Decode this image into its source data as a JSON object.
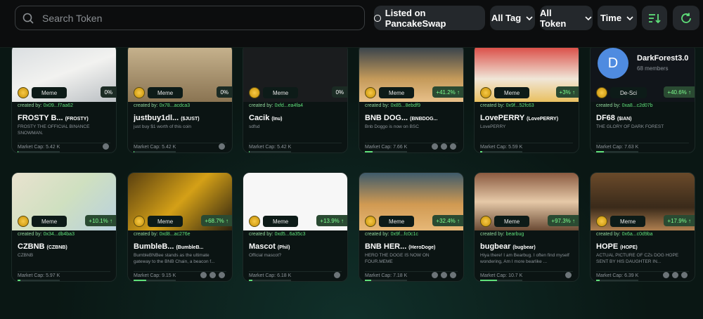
{
  "search": {
    "placeholder": "Search Token"
  },
  "filters": {
    "listed": "Listed on PancakeSwap",
    "tag": "All Tag",
    "token": "All Token",
    "time": "Time"
  },
  "colors": {
    "accent": "#5fe07a",
    "bg": "#0a1714",
    "topbar": "#0c0d0e"
  },
  "cards": [
    {
      "tag": "Meme",
      "pct": "0%",
      "creator": "0x09...f7aa62",
      "name": "FROSTY B...",
      "ticker": "(FROSTY)",
      "desc": "FROSTY THE OFFICIAL BINANCE SNOWMAN.",
      "market_cap": "Market Cap: 5.42 K",
      "progress": 0.02
    },
    {
      "tag": "Meme",
      "pct": "0%",
      "creator": "0x78...acdca3",
      "name": "justbuy1dl...",
      "ticker": "($JUST)",
      "desc": "just buy $1 worth of this coin",
      "market_cap": "Market Cap: 5.42 K",
      "progress": 0.02
    },
    {
      "tag": "Meme",
      "pct": "0%",
      "creator": "0xfd...ea4fa4",
      "name": "Cacik",
      "ticker": "(Inu)",
      "desc": "sdfsd",
      "market_cap": "Market Cap: 5.42 K",
      "progress": 0.02
    },
    {
      "tag": "Meme",
      "pct": "+41.2% ↑",
      "creator": "0x85...8ebdf9",
      "name": "BNB DOG...",
      "ticker": "(BNBDOG...",
      "desc": "Bnb Doggo is now on BSC",
      "market_cap": "Market Cap: 7.66 K",
      "progress": 0.18
    },
    {
      "tag": "Meme",
      "pct": "+3% ↑",
      "creator": "0x9f...52fc63",
      "name": "LovePERRY",
      "ticker": "(LovePERRY)",
      "desc": "LovePERRY",
      "market_cap": "Market Cap: 5.59 K",
      "progress": 0.05
    },
    {
      "tag": "De-Sci",
      "pct": "+40.6% ↑",
      "creator": "0xa8...c2d07b",
      "name": "DF68",
      "ticker": "($IAN)",
      "desc": "THE GLORY OF DARK FOREST",
      "market_cap": "Market Cap: 7.63 K",
      "progress": 0.18,
      "community_name": "DarkForest3.0",
      "community_members": "68 members",
      "community_letter": "D"
    },
    {
      "tag": "Meme",
      "pct": "+10.1% ↑",
      "creator": "0x34...db4ba3",
      "name": "CZBNB",
      "ticker": "(CZBNB)",
      "desc": "CZBNB",
      "market_cap": "Market Cap: 5.97 K",
      "progress": 0.06
    },
    {
      "tag": "Meme",
      "pct": "+68.7% ↑",
      "creator": "0xd8...ac276e",
      "name": "BumbleB...",
      "ticker": "(BumbleB...",
      "desc": "BumbleBNBee stands as the ultimate gateway to the BNB Chain, a beacon f...",
      "market_cap": "Market Cap: 9.15 K",
      "progress": 0.3
    },
    {
      "tag": "Meme",
      "pct": "+13.9% ↑",
      "creator": "0xd5...6a35c3",
      "name": "Mascot",
      "ticker": "(Phil)",
      "desc": "Official mascot?",
      "market_cap": "Market Cap: 6.18 K",
      "progress": 0.08
    },
    {
      "tag": "Meme",
      "pct": "+32.4% ↑",
      "creator": "0x9f...fc0c1c",
      "name": "BNB HER...",
      "ticker": "(HeroDoge)",
      "desc": "HERO THE DOGE IS NOW ON FOUR.MEME",
      "market_cap": "Market Cap: 7.18 K",
      "progress": 0.15
    },
    {
      "tag": "Meme",
      "pct": "+97.3% ↑",
      "creator": "bearbug",
      "name": "bugbear",
      "ticker": "(bugbear)",
      "desc": "Hiya there! I am Bearbug. I often find myself wondering, Am I more bearlike ...",
      "market_cap": "Market Cap: 10.7 K",
      "progress": 0.4
    },
    {
      "tag": "Meme",
      "pct": "+17.9% ↑",
      "creator": "0x6a...c0d9ba",
      "name": "HOPE",
      "ticker": "(HOPE)",
      "desc": "ACTUAL PICTURE OF CZs DOG HOPE SENT BY HIS DAUGHTER IN...",
      "market_cap": "Market Cap: 6.39 K",
      "progress": 0.09
    }
  ],
  "labels": {
    "created_by": "created by:"
  }
}
